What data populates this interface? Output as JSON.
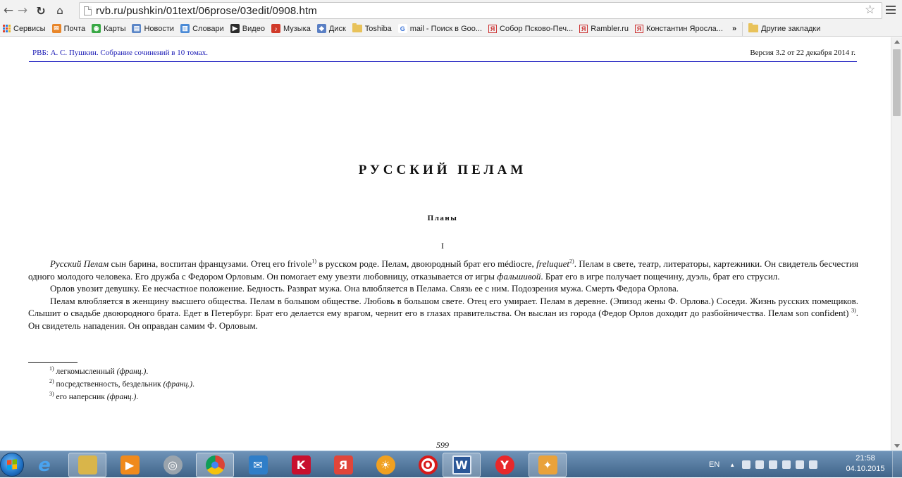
{
  "browser": {
    "url": "rvb.ru/pushkin/01text/06prose/03edit/0908.htm",
    "bookmarks": [
      {
        "label": "Сервисы",
        "icon": "apps-icon"
      },
      {
        "label": "Почта",
        "icon": "mail-icon"
      },
      {
        "label": "Карты",
        "icon": "maps-icon"
      },
      {
        "label": "Новости",
        "icon": "news-icon"
      },
      {
        "label": "Словари",
        "icon": "dictionary-icon"
      },
      {
        "label": "Видео",
        "icon": "video-icon"
      },
      {
        "label": "Музыка",
        "icon": "music-icon"
      },
      {
        "label": "Диск",
        "icon": "disk-icon"
      },
      {
        "label": "Toshiba",
        "icon": "folder-icon"
      },
      {
        "label": "mail - Поиск в Goo...",
        "icon": "google-icon"
      },
      {
        "label": "Собор Псково-Печ...",
        "icon": "yandex-icon"
      },
      {
        "label": "Rambler.ru",
        "icon": "yandex-icon"
      },
      {
        "label": "Константин Яросла...",
        "icon": "yandex-icon"
      }
    ],
    "more_label": "»",
    "other_bookmarks": "Другие закладки"
  },
  "page": {
    "header_left": "РВБ: А. С. Пушкин. Собрание сочинений в 10 томах.",
    "header_right": "Версия 3.2 от 22 декабря 2014 г.",
    "title": "РУССКИЙ ПЕЛАМ",
    "subtitle": "Планы",
    "section_number": "I",
    "p1": {
      "t1": "Русский Пелам",
      "t2": " сын барина, воспитан французами. Отец его frivole",
      "s1": "1)",
      "t3": " в русском роде. Пелам, двоюродный брат его médiocre, ",
      "t4": "frеluquet",
      "s2": "2)",
      "t5": ". Пелам в свете, театр, литераторы, картежники. Он свидетель бесчестия одного молодого человека. Его дружба с Федором Орловым. Он помогает ему увезти любовницу, отказывается от игры ",
      "t6": "фальшивой",
      "t7": ". Брат его в игре получает пощечину, дуэль, брат его струсил."
    },
    "p2": "Орлов увозит девушку. Ее несчастное положение. Бедность. Разврат мужа. Она влюбляется в Пелама. Связь ее с ним. Подозрения мужа. Смерть Федора Орлова.",
    "p3": {
      "t1": "Пелам влюбляется в женщину высшего общества. Пелам в большом обществе. Любовь в большом свете. Отец его умирает. Пелам в деревне. (Эпизод жены Ф. Орлова.) Соседи. Жизнь русских помещиков. Слышит о свадьбе двоюродного брата. Едет в Петербург. Брат его делается ему врагом, чернит его в глазах правительства. Он выслан из города (Федор Орлов доходит до разбойничества. Пелам son confident) ",
      "s3": "3)",
      "t2": ". Он свидетель нападения. Он оправдан самим Ф. Орловым."
    },
    "footnotes": [
      {
        "num": "1)",
        "text": " легкомысленный ",
        "note": "(франц.)",
        "end": "."
      },
      {
        "num": "2)",
        "text": " посредственность, бездельник ",
        "note": "(франц.)",
        "end": "."
      },
      {
        "num": "3)",
        "text": " его наперсник ",
        "note": "(франц.)",
        "end": "."
      }
    ],
    "page_number": "599"
  },
  "taskbar": {
    "apps": [
      {
        "name": "internet-explorer",
        "icon": "ie-icon",
        "color": "#2a8be0",
        "glyph": "e"
      },
      {
        "name": "file-explorer",
        "icon": "folder-icon",
        "color": "#d9b54a",
        "glyph": ""
      },
      {
        "name": "media-player",
        "icon": "media-player-icon",
        "color": "#f08a1c",
        "glyph": "▶"
      },
      {
        "name": "disc-app",
        "icon": "disc-icon",
        "color": "#9aa4ad",
        "glyph": "◎"
      },
      {
        "name": "chrome",
        "icon": "chrome-icon",
        "color": "#dd4433",
        "glyph": "●"
      },
      {
        "name": "mail-app",
        "icon": "mail-icon",
        "color": "#2f7ec8",
        "glyph": "✉"
      },
      {
        "name": "kaspersky",
        "icon": "kaspersky-icon",
        "color": "#c8102e",
        "glyph": "K"
      },
      {
        "name": "yandex-app",
        "icon": "yandex-icon",
        "color": "#e0453a",
        "glyph": "Я"
      },
      {
        "name": "sun-app",
        "icon": "sun-icon",
        "color": "#f0a020",
        "glyph": "☀"
      },
      {
        "name": "opera",
        "icon": "opera-icon",
        "color": "#d81a1a",
        "glyph": "O"
      },
      {
        "name": "word",
        "icon": "word-icon",
        "color": "#2b5797",
        "glyph": "W"
      },
      {
        "name": "yandex-browser",
        "icon": "yandex-browser-icon",
        "color": "#e8282b",
        "glyph": "Y"
      },
      {
        "name": "paint-app",
        "icon": "paint-icon",
        "color": "#e9a23b",
        "glyph": "✦"
      }
    ],
    "lang": "EN",
    "time": "21:58",
    "date": "04.10.2015"
  }
}
